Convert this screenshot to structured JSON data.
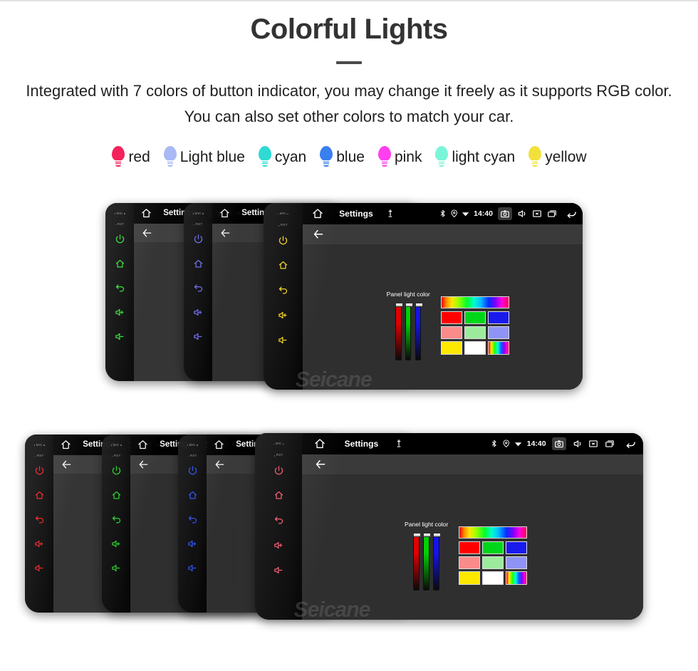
{
  "hero": {
    "title": "Colorful Lights",
    "subtitle": "Integrated with 7 colors of button indicator, you may change it freely as it supports RGB color. You can also set other colors to match your car."
  },
  "legend": {
    "items": [
      {
        "label": "red",
        "color": "#f4225c"
      },
      {
        "label": "Light blue",
        "color": "#a8b9f4"
      },
      {
        "label": "cyan",
        "color": "#2fd9d4"
      },
      {
        "label": "blue",
        "color": "#3a7ff0"
      },
      {
        "label": "pink",
        "color": "#ff3ff0"
      },
      {
        "label": "light cyan",
        "color": "#7bf5d8"
      },
      {
        "label": "yellow",
        "color": "#f2e03c"
      }
    ]
  },
  "device": {
    "bezel_keys": [
      "power-key",
      "home-key",
      "back-key",
      "volume-up-key",
      "volume-down-key"
    ],
    "bezel_labels": {
      "mic": "MIC",
      "reset": "RST"
    },
    "statusbar": {
      "title": "Settings",
      "clock": "14:40",
      "icons_left": [
        "home-icon",
        "settings-title",
        "mic-icon"
      ],
      "icons_right": [
        "bluetooth-icon",
        "location-icon",
        "wifi-icon",
        "camera-icon",
        "volume-icon",
        "close-icon",
        "recents-icon",
        "back-icon"
      ]
    },
    "actionbar": {
      "back_label": "back-arrow"
    },
    "panel": {
      "label": "Panel light color",
      "sliders": [
        {
          "name": "red-slider",
          "color": "#e20000",
          "value": 100
        },
        {
          "name": "green-slider",
          "color": "#00d000",
          "value": 100
        },
        {
          "name": "blue-slider",
          "color": "#1414e8",
          "value": 100
        }
      ],
      "swatch_rows": [
        [
          "#ff0000",
          "#00d619",
          "#1a1aee"
        ],
        [
          "#f98b8b",
          "#9ceb9c",
          "#8f93f5"
        ],
        [
          "#ffe800",
          "#ffffff",
          "spectrum"
        ]
      ],
      "spectrum_bar": "spectrum"
    }
  },
  "units": {
    "top_row": [
      {
        "name": "unit-green",
        "key_color": "#2ee02e"
      },
      {
        "name": "unit-blue",
        "key_color": "#6b6bf2"
      },
      {
        "name": "unit-yellow",
        "key_color": "#f2d21a"
      }
    ],
    "bottom_row": [
      {
        "name": "unit-red",
        "key_color": "#ee1a1a"
      },
      {
        "name": "unit-green-2",
        "key_color": "#24d424"
      },
      {
        "name": "unit-blue-2",
        "key_color": "#2b4df0"
      },
      {
        "name": "unit-salmon",
        "key_color": "#f0556b"
      }
    ]
  },
  "watermark": {
    "text": "Seicane"
  }
}
